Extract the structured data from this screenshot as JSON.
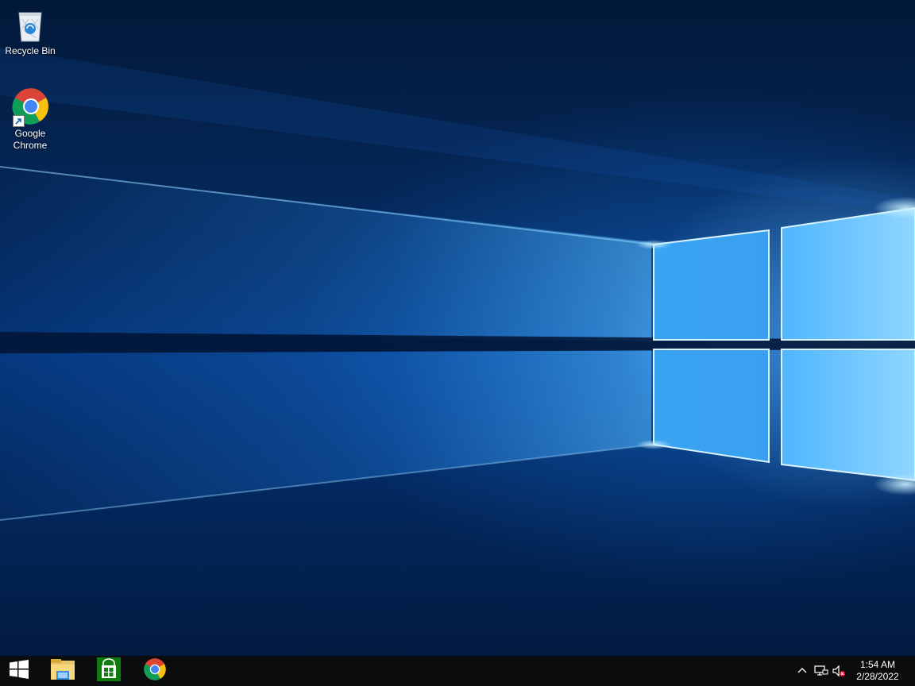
{
  "desktop": {
    "icons": [
      {
        "label": "Recycle Bin",
        "icon": "recycle-bin-icon"
      },
      {
        "label": "Google Chrome",
        "icon": "chrome-icon",
        "shortcut": true
      }
    ]
  },
  "taskbar": {
    "pinned": [
      {
        "icon": "windows-start-icon"
      },
      {
        "icon": "file-explorer-icon"
      },
      {
        "icon": "microsoft-store-icon"
      },
      {
        "icon": "chrome-icon"
      }
    ],
    "tray": {
      "icons": [
        "chevron-up-icon",
        "network-icon",
        "volume-muted-icon"
      ],
      "time": "1:54 AM",
      "date": "2/28/2022"
    }
  },
  "colors": {
    "accent": "#0078d7",
    "taskbar": "#0b0c0d",
    "store_green": "#107c10"
  }
}
